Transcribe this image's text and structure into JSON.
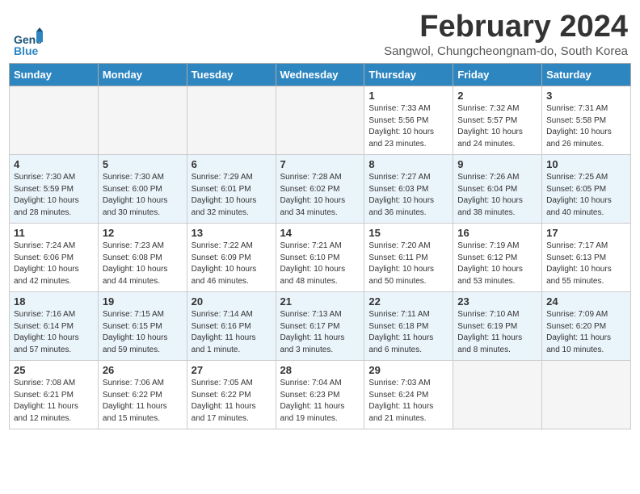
{
  "header": {
    "logo_line1": "General",
    "logo_line2": "Blue",
    "title": "February 2024",
    "location": "Sangwol, Chungcheongnam-do, South Korea"
  },
  "days_of_week": [
    "Sunday",
    "Monday",
    "Tuesday",
    "Wednesday",
    "Thursday",
    "Friday",
    "Saturday"
  ],
  "weeks": [
    [
      {
        "day": "",
        "info": ""
      },
      {
        "day": "",
        "info": ""
      },
      {
        "day": "",
        "info": ""
      },
      {
        "day": "",
        "info": ""
      },
      {
        "day": "1",
        "info": "Sunrise: 7:33 AM\nSunset: 5:56 PM\nDaylight: 10 hours\nand 23 minutes."
      },
      {
        "day": "2",
        "info": "Sunrise: 7:32 AM\nSunset: 5:57 PM\nDaylight: 10 hours\nand 24 minutes."
      },
      {
        "day": "3",
        "info": "Sunrise: 7:31 AM\nSunset: 5:58 PM\nDaylight: 10 hours\nand 26 minutes."
      }
    ],
    [
      {
        "day": "4",
        "info": "Sunrise: 7:30 AM\nSunset: 5:59 PM\nDaylight: 10 hours\nand 28 minutes."
      },
      {
        "day": "5",
        "info": "Sunrise: 7:30 AM\nSunset: 6:00 PM\nDaylight: 10 hours\nand 30 minutes."
      },
      {
        "day": "6",
        "info": "Sunrise: 7:29 AM\nSunset: 6:01 PM\nDaylight: 10 hours\nand 32 minutes."
      },
      {
        "day": "7",
        "info": "Sunrise: 7:28 AM\nSunset: 6:02 PM\nDaylight: 10 hours\nand 34 minutes."
      },
      {
        "day": "8",
        "info": "Sunrise: 7:27 AM\nSunset: 6:03 PM\nDaylight: 10 hours\nand 36 minutes."
      },
      {
        "day": "9",
        "info": "Sunrise: 7:26 AM\nSunset: 6:04 PM\nDaylight: 10 hours\nand 38 minutes."
      },
      {
        "day": "10",
        "info": "Sunrise: 7:25 AM\nSunset: 6:05 PM\nDaylight: 10 hours\nand 40 minutes."
      }
    ],
    [
      {
        "day": "11",
        "info": "Sunrise: 7:24 AM\nSunset: 6:06 PM\nDaylight: 10 hours\nand 42 minutes."
      },
      {
        "day": "12",
        "info": "Sunrise: 7:23 AM\nSunset: 6:08 PM\nDaylight: 10 hours\nand 44 minutes."
      },
      {
        "day": "13",
        "info": "Sunrise: 7:22 AM\nSunset: 6:09 PM\nDaylight: 10 hours\nand 46 minutes."
      },
      {
        "day": "14",
        "info": "Sunrise: 7:21 AM\nSunset: 6:10 PM\nDaylight: 10 hours\nand 48 minutes."
      },
      {
        "day": "15",
        "info": "Sunrise: 7:20 AM\nSunset: 6:11 PM\nDaylight: 10 hours\nand 50 minutes."
      },
      {
        "day": "16",
        "info": "Sunrise: 7:19 AM\nSunset: 6:12 PM\nDaylight: 10 hours\nand 53 minutes."
      },
      {
        "day": "17",
        "info": "Sunrise: 7:17 AM\nSunset: 6:13 PM\nDaylight: 10 hours\nand 55 minutes."
      }
    ],
    [
      {
        "day": "18",
        "info": "Sunrise: 7:16 AM\nSunset: 6:14 PM\nDaylight: 10 hours\nand 57 minutes."
      },
      {
        "day": "19",
        "info": "Sunrise: 7:15 AM\nSunset: 6:15 PM\nDaylight: 10 hours\nand 59 minutes."
      },
      {
        "day": "20",
        "info": "Sunrise: 7:14 AM\nSunset: 6:16 PM\nDaylight: 11 hours\nand 1 minute."
      },
      {
        "day": "21",
        "info": "Sunrise: 7:13 AM\nSunset: 6:17 PM\nDaylight: 11 hours\nand 3 minutes."
      },
      {
        "day": "22",
        "info": "Sunrise: 7:11 AM\nSunset: 6:18 PM\nDaylight: 11 hours\nand 6 minutes."
      },
      {
        "day": "23",
        "info": "Sunrise: 7:10 AM\nSunset: 6:19 PM\nDaylight: 11 hours\nand 8 minutes."
      },
      {
        "day": "24",
        "info": "Sunrise: 7:09 AM\nSunset: 6:20 PM\nDaylight: 11 hours\nand 10 minutes."
      }
    ],
    [
      {
        "day": "25",
        "info": "Sunrise: 7:08 AM\nSunset: 6:21 PM\nDaylight: 11 hours\nand 12 minutes."
      },
      {
        "day": "26",
        "info": "Sunrise: 7:06 AM\nSunset: 6:22 PM\nDaylight: 11 hours\nand 15 minutes."
      },
      {
        "day": "27",
        "info": "Sunrise: 7:05 AM\nSunset: 6:22 PM\nDaylight: 11 hours\nand 17 minutes."
      },
      {
        "day": "28",
        "info": "Sunrise: 7:04 AM\nSunset: 6:23 PM\nDaylight: 11 hours\nand 19 minutes."
      },
      {
        "day": "29",
        "info": "Sunrise: 7:03 AM\nSunset: 6:24 PM\nDaylight: 11 hours\nand 21 minutes."
      },
      {
        "day": "",
        "info": ""
      },
      {
        "day": "",
        "info": ""
      }
    ]
  ]
}
